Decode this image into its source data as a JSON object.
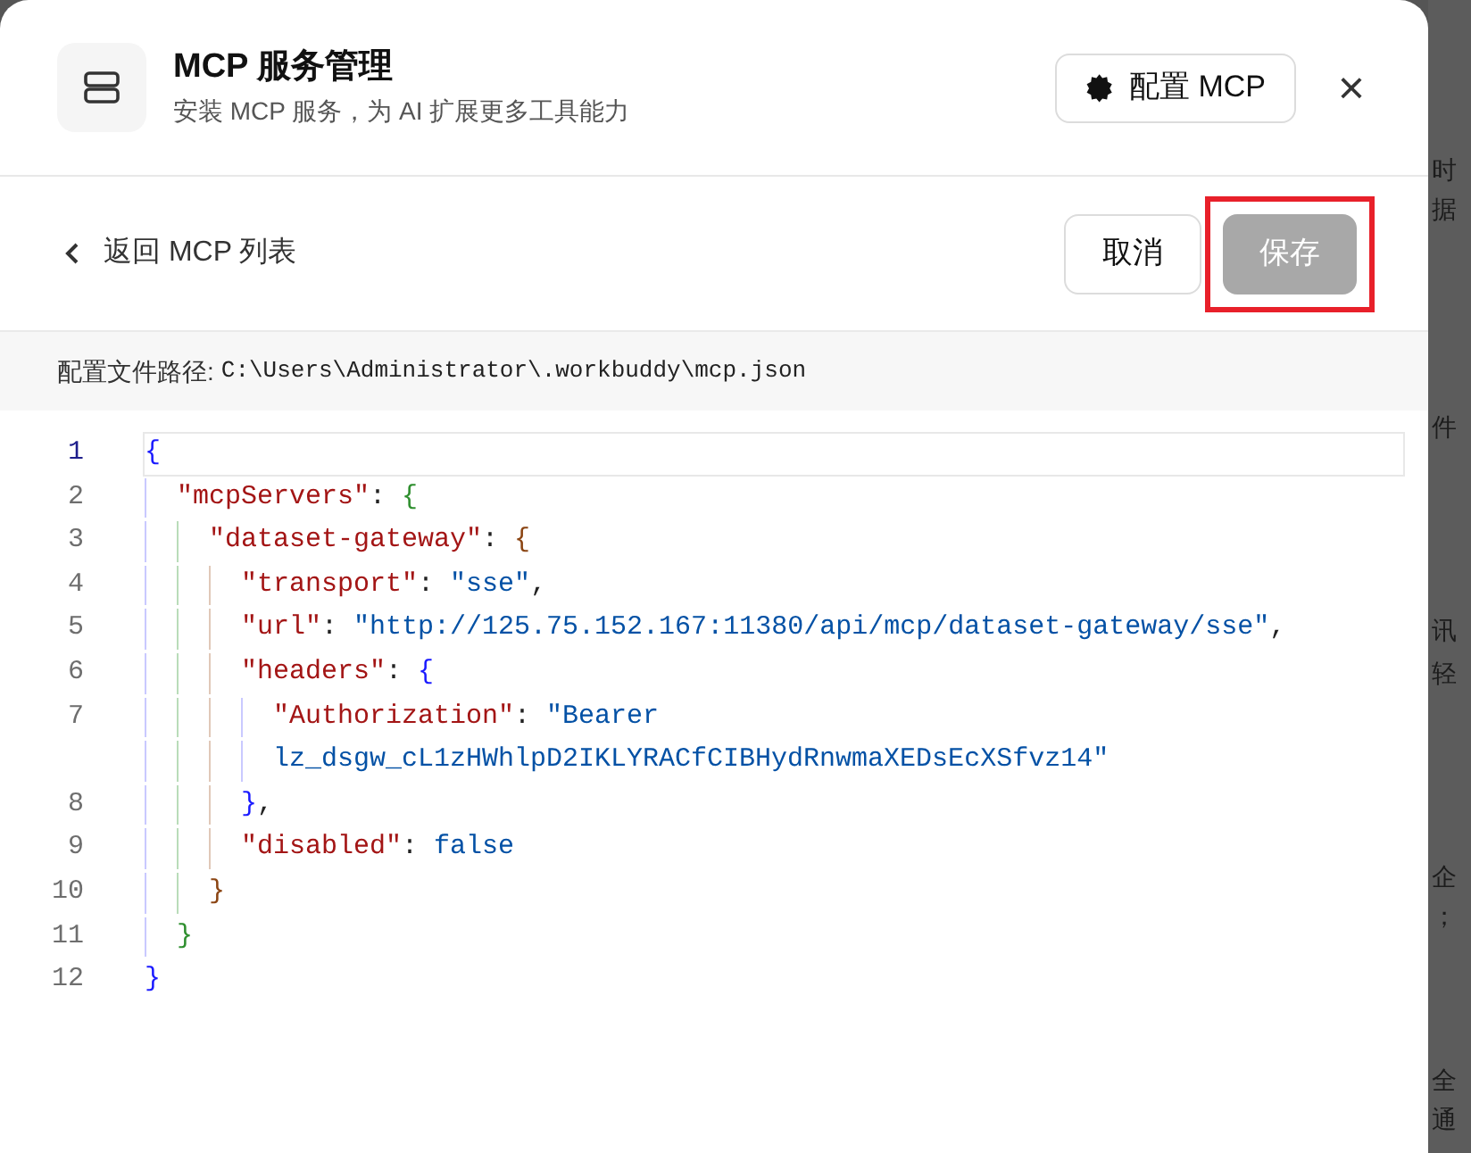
{
  "dialog": {
    "title": "MCP 服务管理",
    "subtitle": "安装 MCP 服务，为 AI 扩展更多工具能力",
    "config_button": "配置 MCP",
    "close": "×"
  },
  "toolbar": {
    "back": "返回 MCP 列表",
    "cancel": "取消",
    "save": {
      "label": "保存",
      "disabled": true,
      "highlighted": true
    }
  },
  "path_bar": {
    "label": "配置文件路径:",
    "path": "C:\\Users\\Administrator\\.workbuddy\\mcp.json"
  },
  "editor": {
    "lines": [
      {
        "number": "1",
        "current": true,
        "tokens": [
          {
            "kind": "bracket",
            "text": "{",
            "color": "#1a1aff"
          }
        ]
      },
      {
        "number": "2",
        "current": false,
        "tokens": [
          {
            "kind": "indent"
          },
          {
            "kind": "key",
            "text": "\"mcpServers\""
          },
          {
            "kind": "punct",
            "text": ": "
          },
          {
            "kind": "bracket",
            "text": "{",
            "color": "#2f8f2f"
          }
        ]
      },
      {
        "number": "3",
        "current": false,
        "tokens": [
          {
            "kind": "indent"
          },
          {
            "kind": "indent"
          },
          {
            "kind": "key",
            "text": "\"dataset-gateway\""
          },
          {
            "kind": "punct",
            "text": ": "
          },
          {
            "kind": "bracket",
            "text": "{",
            "color": "#8b4513"
          }
        ]
      },
      {
        "number": "4",
        "current": false,
        "tokens": [
          {
            "kind": "indent"
          },
          {
            "kind": "indent"
          },
          {
            "kind": "indent"
          },
          {
            "kind": "key",
            "text": "\"transport\""
          },
          {
            "kind": "punct",
            "text": ": "
          },
          {
            "kind": "string",
            "text": "\"sse\""
          },
          {
            "kind": "punct",
            "text": ","
          }
        ]
      },
      {
        "number": "5",
        "current": false,
        "tokens": [
          {
            "kind": "indent"
          },
          {
            "kind": "indent"
          },
          {
            "kind": "indent"
          },
          {
            "kind": "key",
            "text": "\"url\""
          },
          {
            "kind": "punct",
            "text": ": "
          },
          {
            "kind": "string",
            "text": "\"http://125.75.152.167:11380/api/mcp/dataset-gateway/sse\""
          },
          {
            "kind": "punct",
            "text": ","
          }
        ]
      },
      {
        "number": "6",
        "current": false,
        "tokens": [
          {
            "kind": "indent"
          },
          {
            "kind": "indent"
          },
          {
            "kind": "indent"
          },
          {
            "kind": "key",
            "text": "\"headers\""
          },
          {
            "kind": "punct",
            "text": ": "
          },
          {
            "kind": "bracket",
            "text": "{",
            "color": "#1a1aff"
          }
        ]
      },
      {
        "number": "7",
        "current": false,
        "tokens": [
          {
            "kind": "indent"
          },
          {
            "kind": "indent"
          },
          {
            "kind": "indent"
          },
          {
            "kind": "indent"
          },
          {
            "kind": "key",
            "text": "\"Authorization\""
          },
          {
            "kind": "punct",
            "text": ": "
          },
          {
            "kind": "string",
            "text": "\"Bearer"
          }
        ]
      },
      {
        "current": false,
        "tokens": [
          {
            "kind": "indent"
          },
          {
            "kind": "indent"
          },
          {
            "kind": "indent"
          },
          {
            "kind": "indent"
          },
          {
            "kind": "string",
            "text": "lz_dsgw_cL1zHWhlpD2IKLYRACfCIBHydRnwmaXEDsEcXSfvz14\""
          }
        ]
      },
      {
        "number": "8",
        "current": false,
        "tokens": [
          {
            "kind": "indent"
          },
          {
            "kind": "indent"
          },
          {
            "kind": "indent"
          },
          {
            "kind": "bracket",
            "text": "}",
            "color": "#1a1aff"
          },
          {
            "kind": "punct",
            "text": ","
          }
        ]
      },
      {
        "number": "9",
        "current": false,
        "tokens": [
          {
            "kind": "indent"
          },
          {
            "kind": "indent"
          },
          {
            "kind": "indent"
          },
          {
            "kind": "key",
            "text": "\"disabled\""
          },
          {
            "kind": "punct",
            "text": ": "
          },
          {
            "kind": "literal",
            "text": "false"
          }
        ]
      },
      {
        "number": "10",
        "current": false,
        "tokens": [
          {
            "kind": "indent"
          },
          {
            "kind": "indent"
          },
          {
            "kind": "bracket",
            "text": "}",
            "color": "#8b4513"
          }
        ]
      },
      {
        "number": "11",
        "current": false,
        "tokens": [
          {
            "kind": "indent"
          },
          {
            "kind": "bracket",
            "text": "}",
            "color": "#2f8f2f"
          }
        ]
      },
      {
        "number": "12",
        "current": false,
        "tokens": [
          {
            "kind": "bracket",
            "text": "}",
            "color": "#1a1aff"
          }
        ]
      }
    ]
  },
  "background_fragments": [
    "时",
    "据",
    "件",
    "讯",
    "轻",
    "企",
    "；",
    "全",
    "通"
  ]
}
